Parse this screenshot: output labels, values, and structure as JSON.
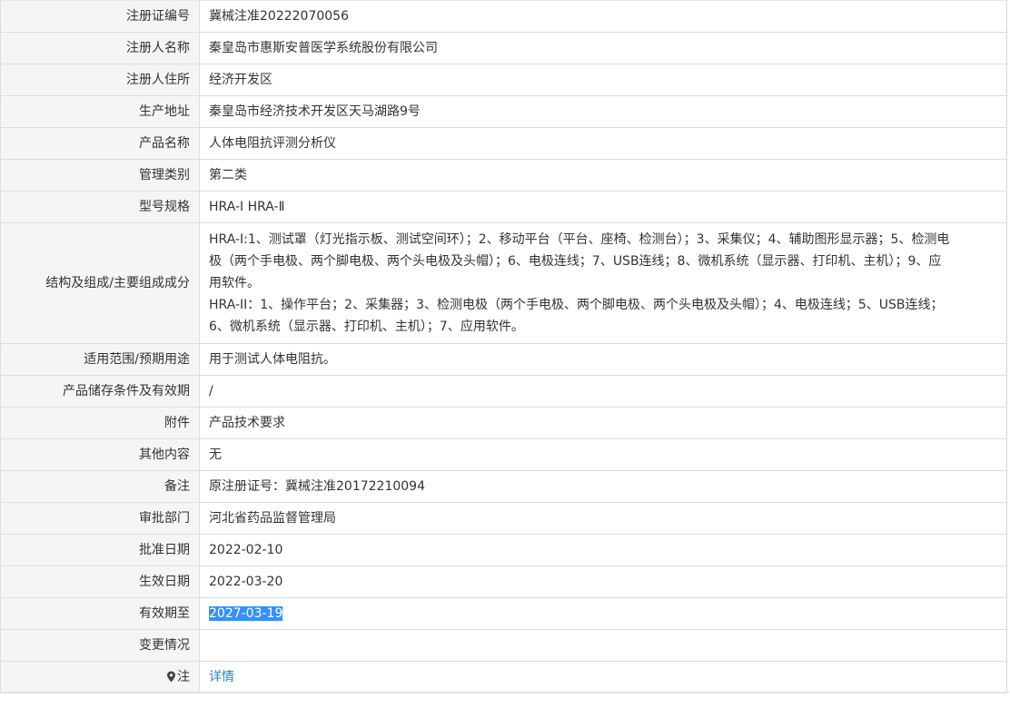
{
  "rows": [
    {
      "label": "注册证编号",
      "value": "冀械注准20222070056"
    },
    {
      "label": "注册人名称",
      "value": "秦皇岛市惠斯安普医学系统股份有限公司"
    },
    {
      "label": "注册人住所",
      "value": "经济开发区"
    },
    {
      "label": "生产地址",
      "value": "秦皇岛市经济技术开发区天马湖路9号"
    },
    {
      "label": "产品名称",
      "value": "人体电阻抗评测分析仪"
    },
    {
      "label": "管理类别",
      "value": "第二类"
    },
    {
      "label": "型号规格",
      "value": "HRA-I HRA-Ⅱ"
    },
    {
      "label": "结构及组成/主要组成成分",
      "value_lines": [
        "HRA-I:1、测试罩（灯光指示板、测试空间环）；2、移动平台（平台、座椅、检测台）；3、采集仪；4、辅助图形显示器；5、检测电",
        "极（两个手电极、两个脚电极、两个头电极及头帽）；6、电极连线；7、USB连线；8、微机系统（显示器、打印机、主机）；9、应",
        "用软件。",
        "HRA-II：1、操作平台；2、采集器；3、检测电极（两个手电极、两个脚电极、两个头电极及头帽）；4、电极连线；5、USB连线；",
        "6、微机系统（显示器、打印机、主机）；7、应用软件。"
      ]
    },
    {
      "label": "适用范围/预期用途",
      "value": "用于测试人体电阻抗。"
    },
    {
      "label": "产品储存条件及有效期",
      "value": "/"
    },
    {
      "label": "附件",
      "value": "产品技术要求"
    },
    {
      "label": "其他内容",
      "value": "无"
    },
    {
      "label": "备注",
      "value": "原注册证号：冀械注准20172210094"
    },
    {
      "label": "审批部门",
      "value": "河北省药品监督管理局"
    },
    {
      "label": "批准日期",
      "value": "2022-02-10"
    },
    {
      "label": "生效日期",
      "value": "2022-03-20"
    },
    {
      "label": "有效期至",
      "value": "2027-03-19"
    },
    {
      "label": "变更情况",
      "value": ""
    },
    {
      "label": "注",
      "link": "详情"
    }
  ],
  "colors": {
    "label_bg": "#f5f5f5",
    "border": "#dddddd",
    "selection": "#3390ff",
    "link": "#1e87c8"
  },
  "icons": {
    "note": "map-pin-icon"
  }
}
